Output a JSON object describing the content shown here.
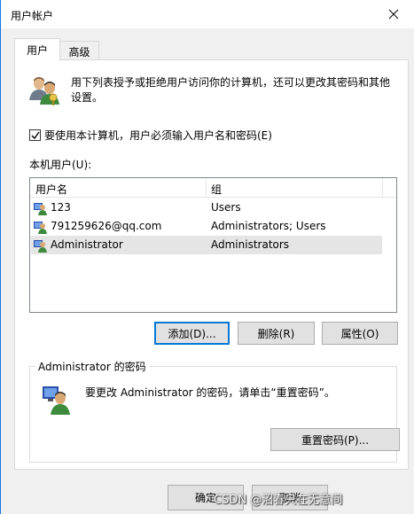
{
  "window": {
    "title": "用户帐户",
    "accent_color": "#1a73e8"
  },
  "tabs": [
    {
      "label": "用户",
      "active": true
    },
    {
      "label": "高级",
      "active": false
    }
  ],
  "panel": {
    "intro_text": "用下列表授予或拒绝用户访问你的计算机，还可以更改其密码和其他设置。",
    "checkbox": {
      "label": "要使用本计算机，用户必须输入用户名和密码(E)",
      "checked": true
    },
    "local_users_label": "本机用户(U):",
    "list": {
      "columns": [
        "用户名",
        "组"
      ],
      "rows": [
        {
          "name": "123",
          "group": "Users",
          "selected": false
        },
        {
          "name": "791259626@qq.com",
          "group": "Administrators; Users",
          "selected": false
        },
        {
          "name": "Administrator",
          "group": "Administrators",
          "selected": true
        }
      ]
    },
    "buttons": {
      "add": "添加(D)...",
      "delete": "删除(R)",
      "properties": "属性(O)"
    },
    "password_group": {
      "title": "Administrator 的密码",
      "text": "要更改 Administrator 的密码，请单击“重置密码”。",
      "reset_button": "重置密码(P)..."
    }
  },
  "footer": {
    "ok": "确定",
    "cancel": "取消"
  },
  "watermark": "CSDN @沼春只在无意间"
}
